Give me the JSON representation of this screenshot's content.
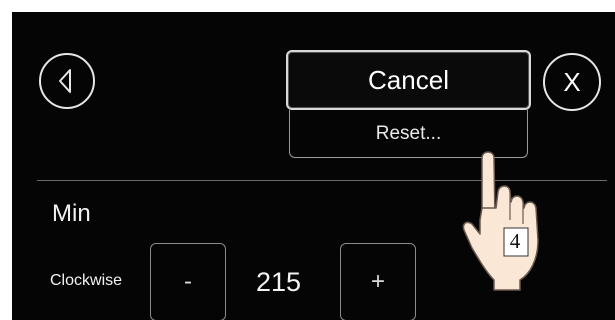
{
  "header": {
    "back_icon": "left-triangle-icon",
    "close_label": "X"
  },
  "dropdown": {
    "cancel_label": "Cancel",
    "reset_label": "Reset..."
  },
  "section": {
    "title": "Min",
    "row_label": "Clockwise",
    "minus_label": "-",
    "value": "215",
    "plus_label": "+"
  },
  "pointer": {
    "icon": "hand-pointer-icon",
    "step_label": "4"
  }
}
